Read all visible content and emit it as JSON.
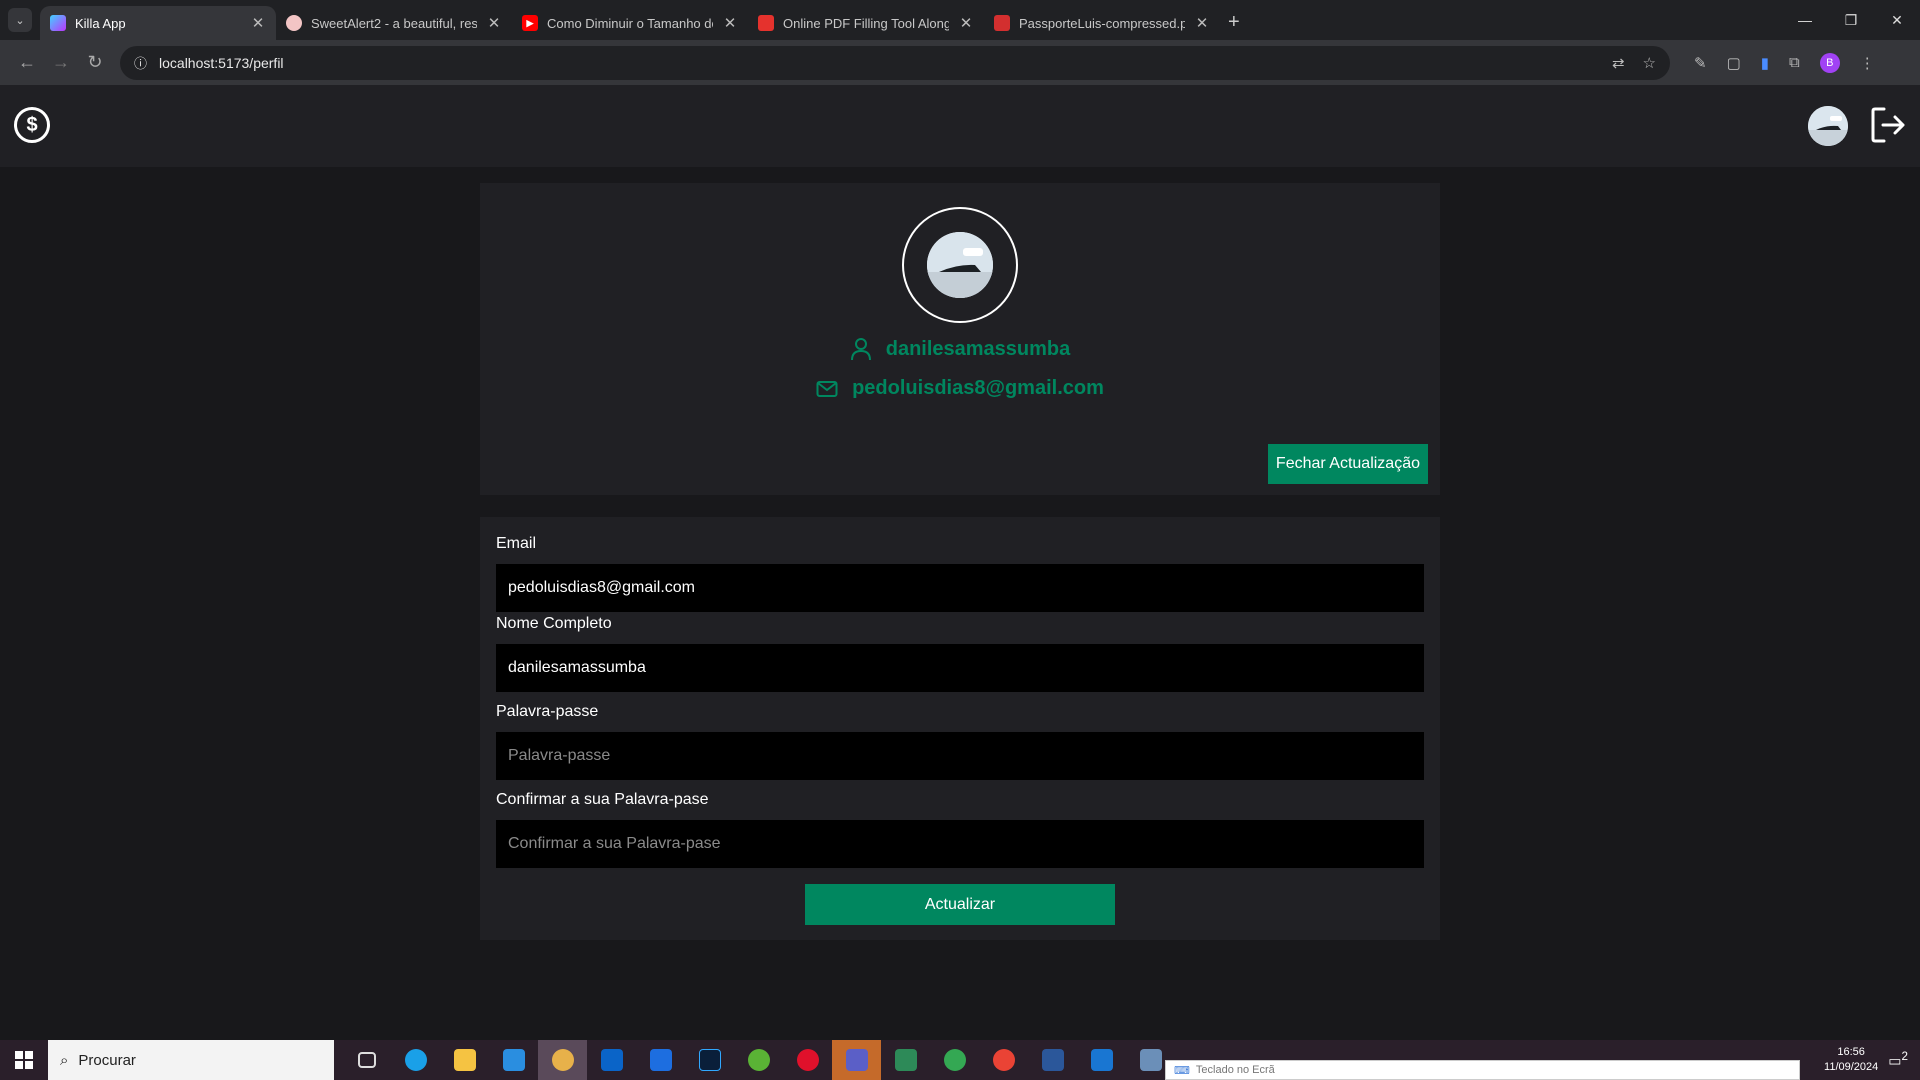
{
  "browser": {
    "tabs": [
      {
        "title": "Killa App",
        "favicon_color": "#8b5cf6",
        "active": true
      },
      {
        "title": "SweetAlert2 - a beautiful, respo",
        "favicon_color": "#e35151",
        "active": false
      },
      {
        "title": "Como Diminuir o Tamanho do",
        "favicon_color": "#ff0000",
        "active": false
      },
      {
        "title": "Online PDF Filling Tool Along w",
        "favicon_color": "#e5322d",
        "active": false
      },
      {
        "title": "PassporteLuis-compressed.pdf",
        "favicon_color": "#d32f2f",
        "active": false
      }
    ],
    "url": "localhost:5173/perfil",
    "profile_initial": "B"
  },
  "app": {
    "logo_symbol": "$"
  },
  "profile": {
    "username": "danilesamassumba",
    "email": "pedoluisdias8@gmail.com",
    "close_button": "Fechar Actualização"
  },
  "form": {
    "email_label": "Email",
    "email_value": "pedoluisdias8@gmail.com",
    "name_label": "Nome Completo",
    "name_value": "danilesamassumba",
    "password_label": "Palavra-passe",
    "password_placeholder": "Palavra-passe",
    "confirm_label": "Confirmar a sua Palavra-pase",
    "confirm_placeholder": "Confirmar a sua Palavra-pase",
    "submit_label": "Actualizar"
  },
  "taskbar": {
    "search_label": "Procurar",
    "time": "16:56",
    "date": "11/09/2024",
    "notification_count": "2",
    "osk_label": "Teclado no Ecrã"
  },
  "colors": {
    "accent": "#00875f",
    "background": "#18181b",
    "card": "#202024"
  }
}
